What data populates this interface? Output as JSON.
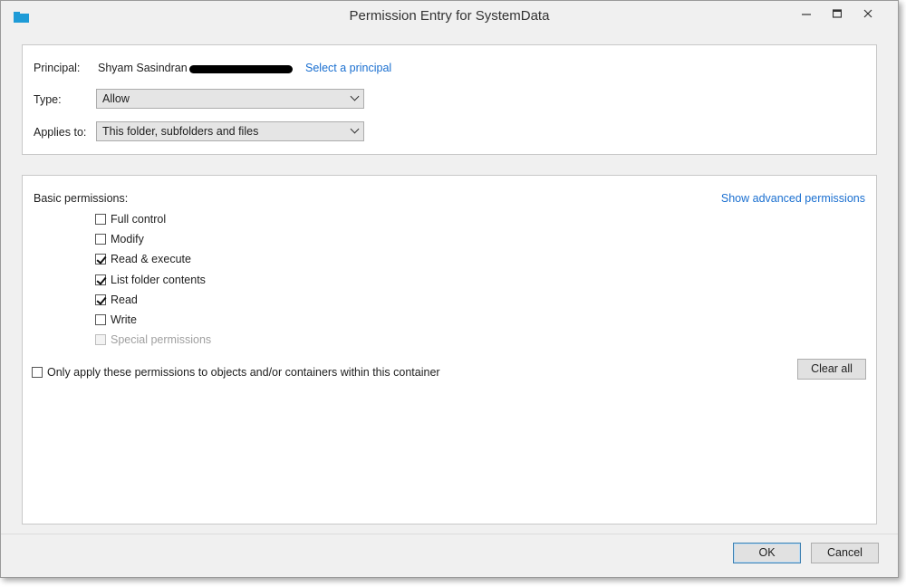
{
  "window": {
    "title": "Permission Entry for SystemData"
  },
  "principal": {
    "label": "Principal:",
    "name": "Shyam Sasindran",
    "select_link": "Select a principal"
  },
  "type": {
    "label": "Type:",
    "value": "Allow"
  },
  "applies_to": {
    "label": "Applies to:",
    "value": "This folder, subfolders and files"
  },
  "basic": {
    "label": "Basic permissions:",
    "advanced_link": "Show advanced permissions",
    "permissions": [
      {
        "label": "Full control",
        "checked": false,
        "enabled": true
      },
      {
        "label": "Modify",
        "checked": false,
        "enabled": true
      },
      {
        "label": "Read & execute",
        "checked": true,
        "enabled": true
      },
      {
        "label": "List folder contents",
        "checked": true,
        "enabled": true
      },
      {
        "label": "Read",
        "checked": true,
        "enabled": true
      },
      {
        "label": "Write",
        "checked": false,
        "enabled": true
      },
      {
        "label": "Special permissions",
        "checked": false,
        "enabled": false
      }
    ]
  },
  "only_apply": {
    "label": "Only apply these permissions to objects and/or containers within this container",
    "checked": false
  },
  "buttons": {
    "clear_all": "Clear all",
    "ok": "OK",
    "cancel": "Cancel"
  },
  "colors": {
    "link": "#1a6fd0",
    "window_bg": "#f0f0f0",
    "panel_bg": "#ffffff"
  }
}
